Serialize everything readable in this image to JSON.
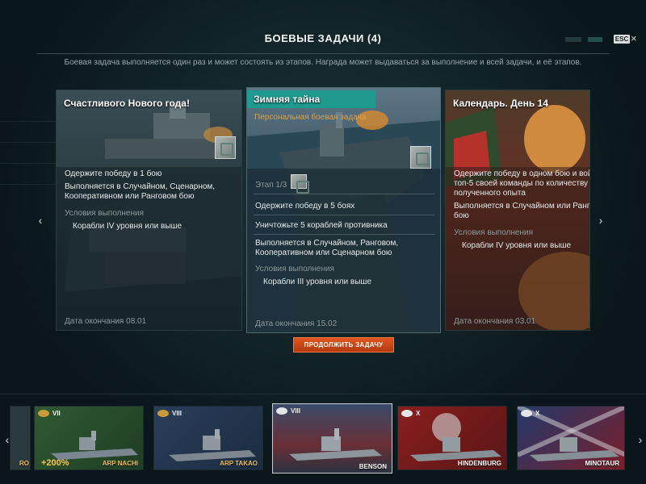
{
  "header": {
    "title": "БОЕВЫЕ ЗАДАЧИ (4)",
    "esc_label": "ESC",
    "close_glyph": "×"
  },
  "subtitle": "Боевая задача выполняется один раз и может состоять из этапов. Награда может выдаваться за выполнение и всей задачи, и её этапов.",
  "nav": {
    "prev_glyph": "‹",
    "next_glyph": "›"
  },
  "cards": {
    "left": {
      "title": "Счастливого Нового года!",
      "task_lines": [
        "Одержите победу в 1 бою",
        "Выполняется в Случайном, Сценарном,",
        "Кооперативном или Ранговом бою"
      ],
      "conditions_label": "Условия выполнения",
      "condition": "Корабли IV уровня или выше",
      "date": "Дата окончания 08.01"
    },
    "center": {
      "title": "Зимняя тайна",
      "subtitle": "Персональная боевая задача",
      "stage": "Этап 1/3",
      "task_1": "Одержите победу в 5 боях",
      "task_2": "Уничтожьте 5 кораблей противника",
      "mode_lines": [
        "Выполняется в Случайном, Ранговом,",
        "Кооперативном или Сценарном бою"
      ],
      "conditions_label": "Условия выполнения",
      "condition": "Корабли III уровня или выше",
      "date": "Дата окончания 15.02"
    },
    "right": {
      "title": "Календарь. День 14",
      "task_lines": [
        "Одержите победу в одном бою и вой",
        "топ-5 своей команды по количеству",
        "полученного опыта",
        "Выполняется в Случайном или Ранго",
        "бою"
      ],
      "conditions_label": "Условия выполнения",
      "condition": "Корабли IV уровня или выше",
      "date": "Дата окончания 03.01"
    }
  },
  "continue_button": "ПРОДОЛЖИТЬ ЗАДАЧУ",
  "carousel": {
    "prev_glyph": "‹",
    "next_glyph": "›",
    "partial_name": "RO",
    "ships": [
      {
        "tier": "VII",
        "name": "ARP NACHI",
        "bonus": "+200%",
        "name_color": "gold"
      },
      {
        "tier": "VIII",
        "name": "ARP TAKAO",
        "name_color": "gold"
      },
      {
        "tier": "VIII",
        "name": "BENSON",
        "name_color": "white"
      },
      {
        "tier": "X",
        "name": "HINDENBURG",
        "name_color": "white"
      },
      {
        "tier": "X",
        "name": "MINOTAUR",
        "name_color": "white"
      }
    ]
  },
  "colors": {
    "accent_teal": "#1e9a8f",
    "button_orange": "#c8461a",
    "gold_name": "#f0c05a"
  }
}
